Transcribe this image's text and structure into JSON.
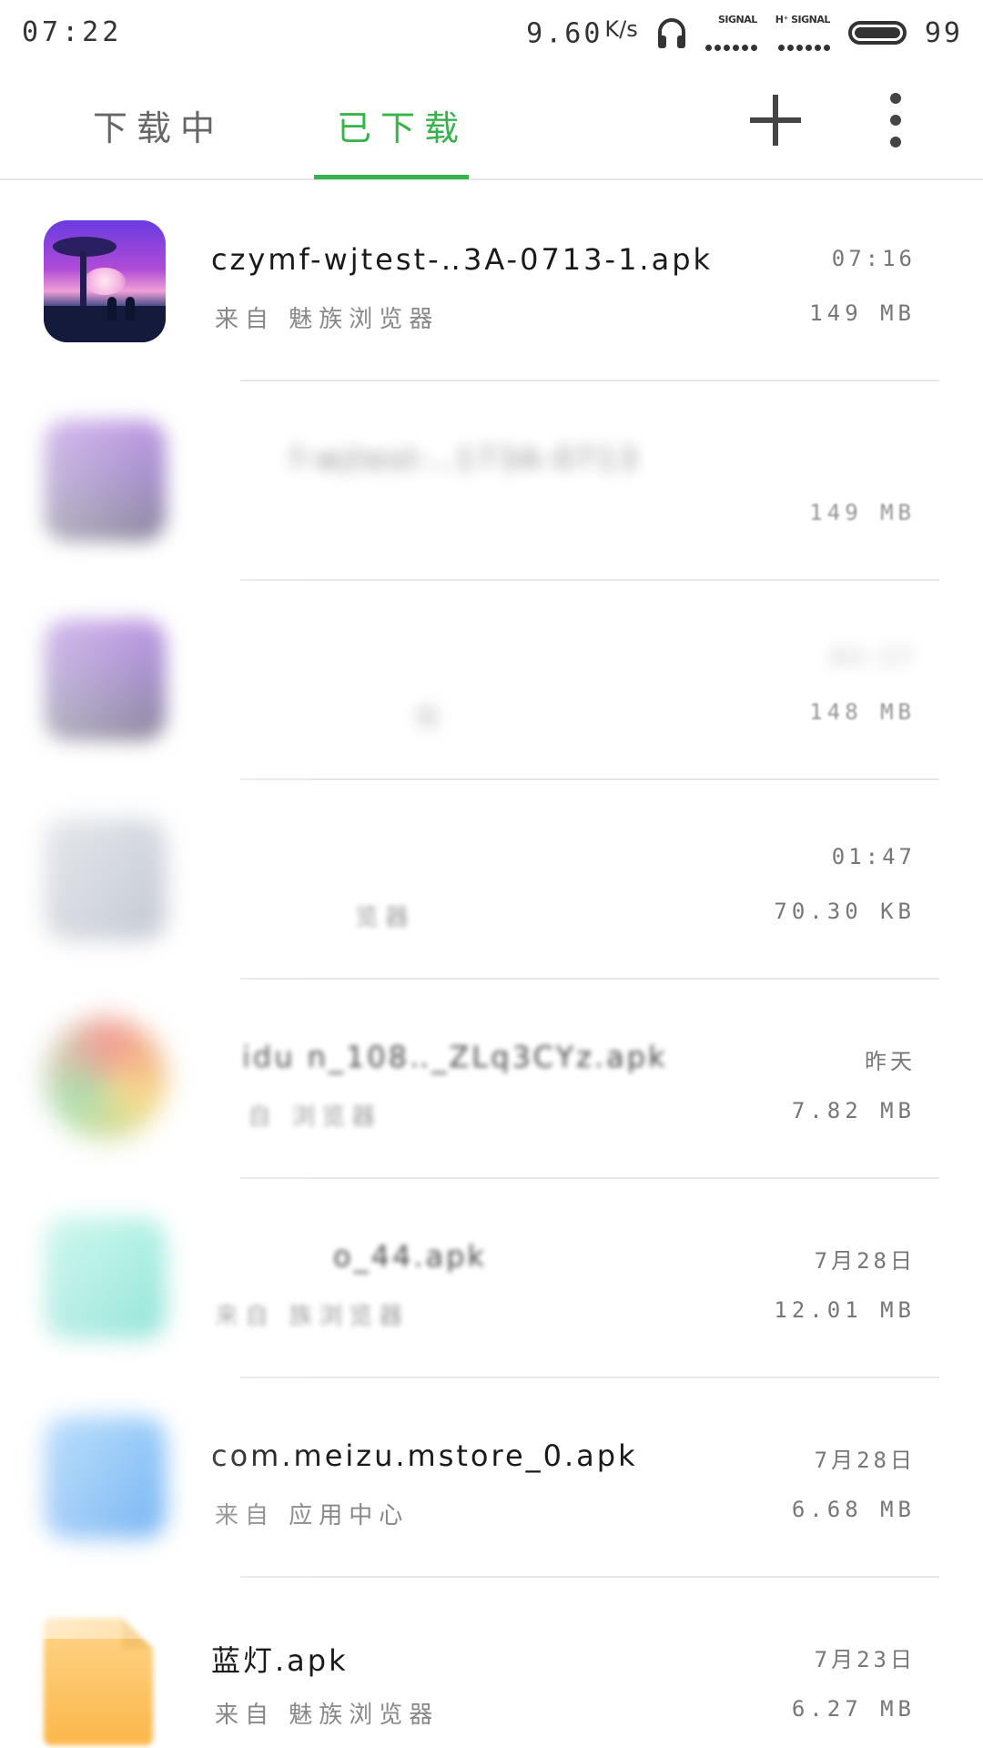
{
  "status_bar": {
    "time": "07:22",
    "net_speed": "9.60",
    "net_speed_unit": "K/s",
    "sim1_label": "SIGNAL",
    "sim2_label": "H⁺ SIGNAL",
    "battery_level": "99",
    "icons": [
      "headphones-icon",
      "signal-icon",
      "battery-icon"
    ]
  },
  "tabs": {
    "downloading": "下载中",
    "downloaded": "已下载",
    "active": "downloaded",
    "accent_color": "#36b34a"
  },
  "toolbar": {
    "add_icon": "plus-icon",
    "more_icon": "more-vertical-icon"
  },
  "downloads": [
    {
      "name": "czymf-wjtest-‥3A-0713-1.apk",
      "source": "来自 魅族浏览器",
      "time": "07:16",
      "size": "149 MB",
      "icon": "game-app-icon"
    },
    {
      "name": "f-wjtest-‥173A-0713",
      "source": "",
      "time": "",
      "size": "149 MB",
      "icon": "blurred-app-icon"
    },
    {
      "name": "",
      "source": "载",
      "time": "03:27",
      "size": "148 MB",
      "icon": "blurred-app-icon"
    },
    {
      "name": "",
      "source": "览器",
      "time": "01:47",
      "size": "70.30 KB",
      "icon": "blurred-app-icon"
    },
    {
      "name": "idu n_108‥_ZLq3CYz.apk",
      "source": "自 浏览器",
      "time": "昨天",
      "size": "7.82 MB",
      "icon": "chrome-app-icon"
    },
    {
      "name": "o_44.apk",
      "source": "来自 族浏览器",
      "time": "7月28日",
      "size": "12.01 MB",
      "icon": "teal-app-icon"
    },
    {
      "name": "com.meizu.mstore_0.apk",
      "source": "来自 应用中心",
      "time": "7月28日",
      "size": "6.68 MB",
      "icon": "app-store-icon"
    },
    {
      "name": "蓝灯.apk",
      "source": "来自 魅族浏览器",
      "time": "7月23日",
      "size": "6.27 MB",
      "icon": "apk-file-icon"
    }
  ]
}
